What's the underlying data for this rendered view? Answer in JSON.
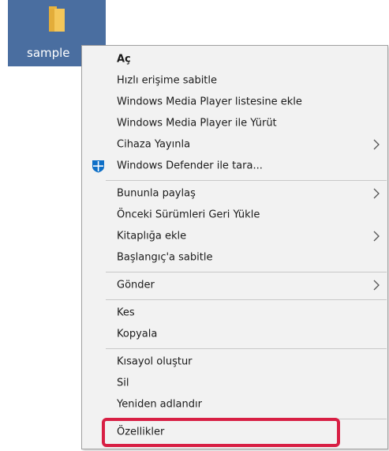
{
  "folder": {
    "name": "sample",
    "icon": "folder-icon"
  },
  "context_menu": {
    "groups": [
      [
        {
          "label": "Aç",
          "bold": true
        },
        {
          "label": "Hızlı erişime sabitle"
        },
        {
          "label": "Windows Media Player listesine ekle"
        },
        {
          "label": "Windows Media Player ile Yürüt"
        },
        {
          "label": "Cihaza Yayınla",
          "submenu": true
        },
        {
          "label": "Windows Defender ile tara...",
          "icon": "windows-defender-icon"
        }
      ],
      [
        {
          "label": "Bununla paylaş",
          "submenu": true
        },
        {
          "label": "Önceki Sürümleri Geri Yükle"
        },
        {
          "label": "Kitaplığa ekle",
          "submenu": true
        },
        {
          "label": "Başlangıç'a sabitle"
        }
      ],
      [
        {
          "label": "Gönder",
          "submenu": true
        }
      ],
      [
        {
          "label": "Kes"
        },
        {
          "label": "Kopyala"
        }
      ],
      [
        {
          "label": "Kısayol oluştur"
        },
        {
          "label": "Sil"
        },
        {
          "label": "Yeniden adlandır"
        }
      ],
      [
        {
          "label": "Özellikler",
          "highlighted": true
        }
      ]
    ]
  },
  "colors": {
    "selection_bg": "#4a6ea0",
    "menu_bg": "#f2f2f2",
    "highlight_border": "#d81f44",
    "defender_blue": "#0e6fc7"
  }
}
